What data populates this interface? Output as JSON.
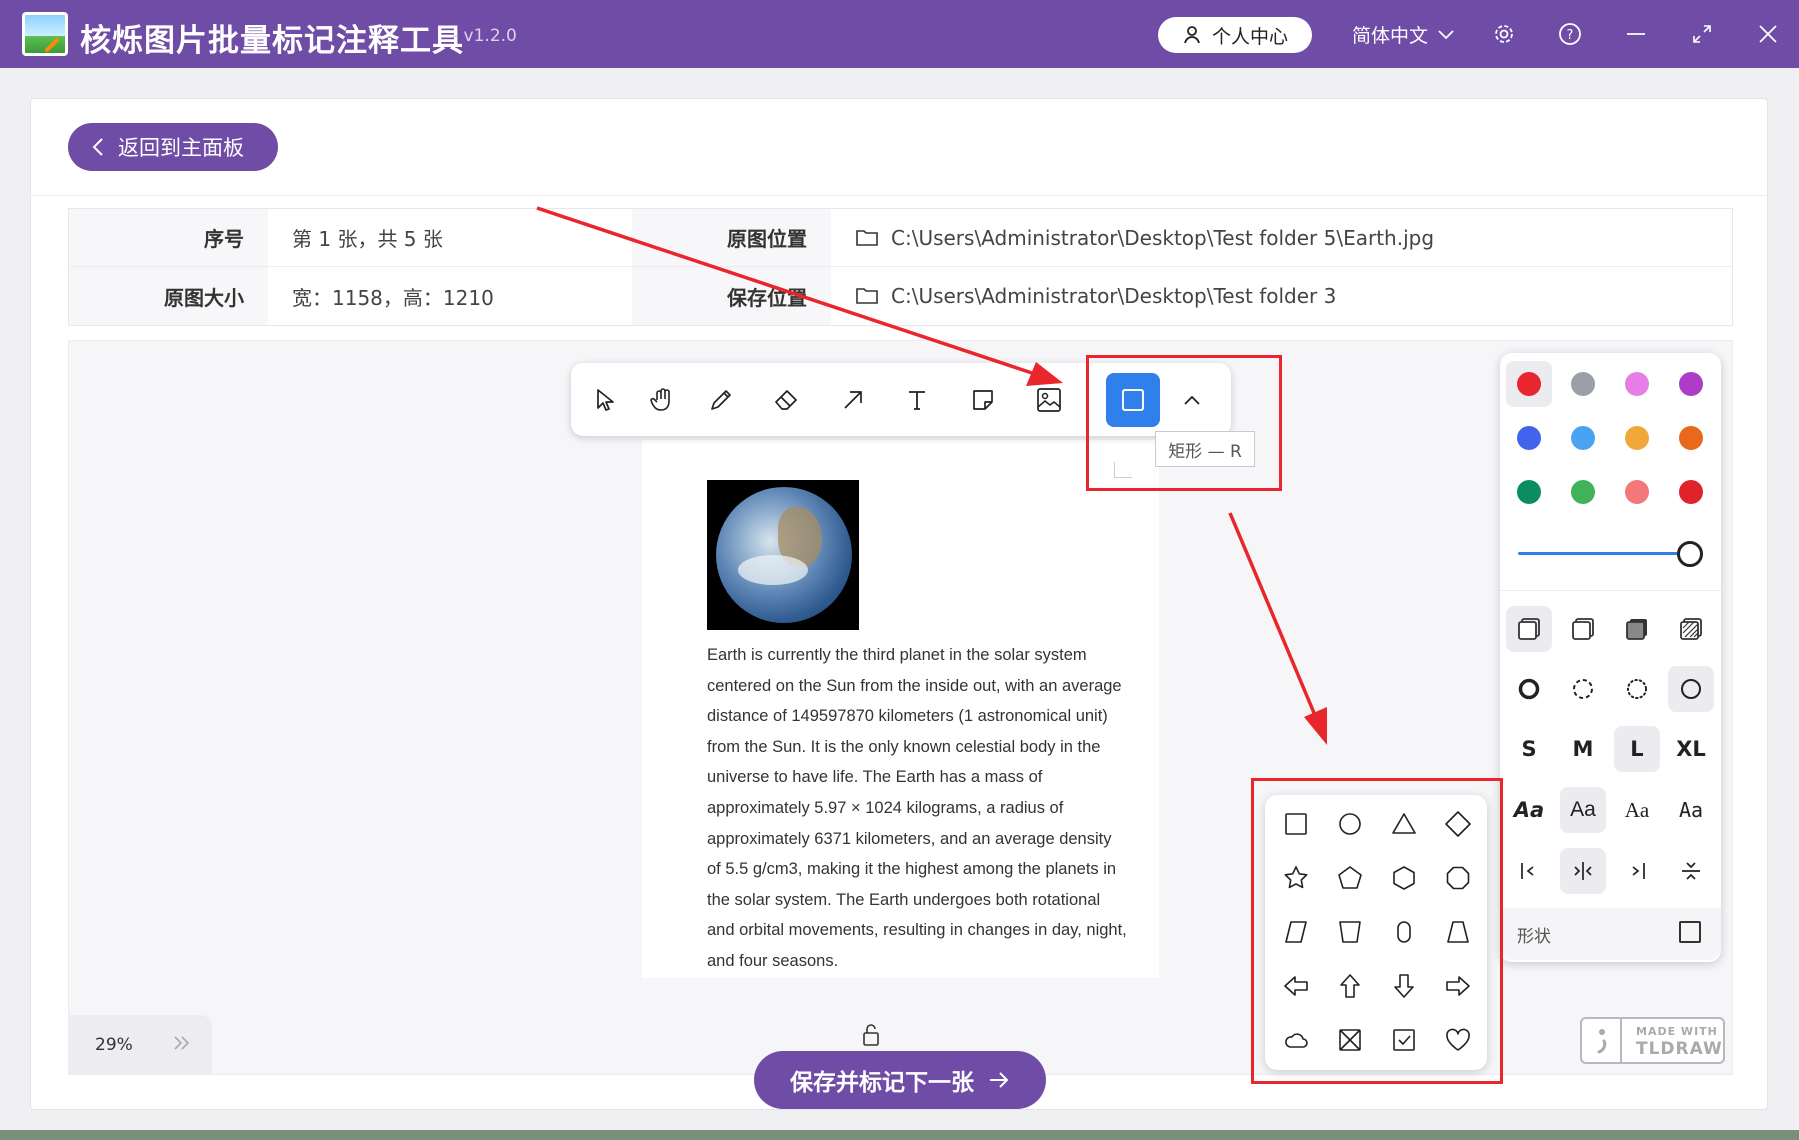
{
  "app": {
    "title": "核烁图片批量标记注释工具",
    "version": "- v1.2.0",
    "user_center": "个人中心",
    "language": "简体中文"
  },
  "back_label": "返回到主面板",
  "info": {
    "index_label": "序号",
    "index_value": "第 1 张，共 5 张",
    "src_label": "原图位置",
    "src_value": "C:\\Users\\Administrator\\Desktop\\Test folder 5\\Earth.jpg",
    "size_label": "原图大小",
    "size_value": "宽：1158，高：1210",
    "save_label": "保存位置",
    "save_value": "C:\\Users\\Administrator\\Desktop\\Test folder 3"
  },
  "toolbar": {
    "tools": [
      "select-icon",
      "hand-icon",
      "pencil-icon",
      "eraser-icon",
      "arrow-icon",
      "text-icon",
      "note-icon",
      "image-icon",
      "rectangle-icon",
      "chevron-up-icon"
    ],
    "active": "rectangle-icon",
    "tooltip": "矩形 — R"
  },
  "document": {
    "text": "Earth is currently the third planet in the solar system centered on the Sun from the inside out, with an average distance of 149597870 kilometers (1 astronomical unit) from the Sun. It is the only known celestial body in the universe to have life. The Earth has a mass of approximately 5.97 × 1024 kilograms, a radius of approximately 6371 kilometers, and an average density of 5.5 g/cm3, making it the highest among the planets in the solar system. The Earth undergoes both rotational and orbital movements, resulting in changes in day, night, and four seasons."
  },
  "style_panel": {
    "colors": [
      "#e8262c",
      "#9aa0a6",
      "#e77ee8",
      "#ad3dc9",
      "#4263eb",
      "#4aa3f0",
      "#f2a73b",
      "#e8681c",
      "#0c8d61",
      "#3fb25a",
      "#f2787a",
      "#e0222a"
    ],
    "sizes": [
      "S",
      "M",
      "L",
      "XL"
    ],
    "size_selected": "L",
    "fonts": [
      "Aa",
      "Aa",
      "Aa",
      "Aa"
    ],
    "shape_label": "形状"
  },
  "shapes": [
    "rectangle",
    "ellipse",
    "triangle",
    "diamond",
    "star",
    "pentagon",
    "hexagon",
    "octagon",
    "rhombus",
    "trapezoid",
    "oval",
    "trapezoid-2",
    "arrow-left",
    "arrow-up",
    "arrow-down",
    "arrow-right",
    "cloud",
    "x-box",
    "check-box",
    "heart"
  ],
  "zoom": "29%",
  "save_next": "保存并标记下一张",
  "made_with": {
    "line1": "MADE WITH",
    "line2": "TLDRAW"
  }
}
